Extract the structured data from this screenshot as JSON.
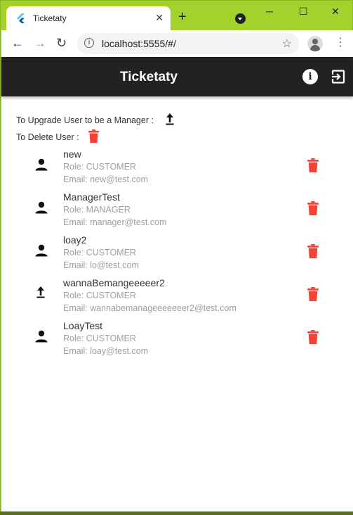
{
  "browser": {
    "tab_title": "Ticketaty",
    "url": "localhost:5555/#/",
    "tab_close": "✕",
    "new_tab": "+",
    "back": "←",
    "forward": "→",
    "reload": "↻",
    "info": "i",
    "star": "☆",
    "menu": "⋮",
    "minimize": "─",
    "maximize": "☐",
    "close": "✕"
  },
  "app": {
    "title": "Ticketaty",
    "info_icon_label": "i",
    "upgrade_legend": "To Upgrade User to be a Manager :",
    "delete_legend": "To Delete User :",
    "accent_color": "#f44336",
    "appbar_color": "#222222"
  },
  "users": [
    {
      "name": "new",
      "role": "Role: CUSTOMER",
      "email": "Email: new@test.com",
      "icon": "person-icon"
    },
    {
      "name": "ManagerTest",
      "role": "Role: MANAGER",
      "email": "Email: manager@test.com",
      "icon": "person-icon"
    },
    {
      "name": "loay2",
      "role": "Role: CUSTOMER",
      "email": "Email: lo@test.com",
      "icon": "person-icon"
    },
    {
      "name": "wannaBemangeeeeer2",
      "role": "Role: CUSTOMER",
      "email": "Email: wannabemanageeeeeeer2@test.com",
      "icon": "upgrade-icon"
    },
    {
      "name": "LoayTest",
      "role": "Role: CUSTOMER",
      "email": "Email: loay@test.com",
      "icon": "person-icon"
    }
  ]
}
